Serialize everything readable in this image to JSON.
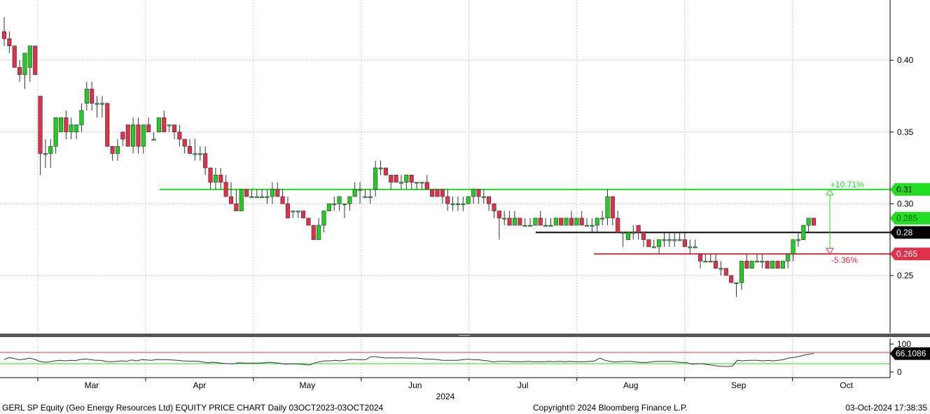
{
  "footer": {
    "title": "GERL SP Equity (Geo Energy Resources Ltd) EQUITY PRICE CHART  Daily 03OCT2023-03OCT2024",
    "copyright": "Copyright© 2024 Bloomberg Finance L.P.",
    "timestamp": "03-Oct-2024 17:38:35"
  },
  "colors": {
    "up": "#22cc22",
    "down": "#e0304a",
    "resistance": "#22dd22",
    "support": "#e0304a",
    "pivot": "#000000",
    "grid": "#c8c8c8",
    "rsi_line": "#333333"
  },
  "chart_data": [
    {
      "type": "candlestick",
      "x_ticks": [
        "Mar",
        "Apr",
        "May",
        "Jun",
        "Jul",
        "Aug",
        "Sep",
        "Oct"
      ],
      "x_year_label": "2024",
      "y_ticks": [
        "0.25",
        "0.30",
        "0.35",
        "0.40"
      ],
      "ylim": [
        0.21,
        0.442
      ],
      "levels": [
        {
          "name": "resistance",
          "value": 0.31,
          "label": "0.31",
          "pct_label": "+10.71%"
        },
        {
          "name": "pivot",
          "value": 0.28,
          "label": "0.28"
        },
        {
          "name": "support",
          "value": 0.265,
          "label": "0.265",
          "pct_label": "-5.36%"
        }
      ],
      "last_price_label": "0.285",
      "ohlc": [
        [
          0.42,
          0.43,
          0.41,
          0.415
        ],
        [
          0.415,
          0.42,
          0.405,
          0.41
        ],
        [
          0.41,
          0.41,
          0.395,
          0.395
        ],
        [
          0.395,
          0.4,
          0.385,
          0.39
        ],
        [
          0.39,
          0.405,
          0.38,
          0.405
        ],
        [
          0.395,
          0.41,
          0.385,
          0.41
        ],
        [
          0.41,
          0.41,
          0.39,
          0.39
        ],
        [
          0.375,
          0.375,
          0.32,
          0.335
        ],
        [
          0.335,
          0.345,
          0.325,
          0.335
        ],
        [
          0.335,
          0.345,
          0.325,
          0.34
        ],
        [
          0.34,
          0.36,
          0.335,
          0.36
        ],
        [
          0.35,
          0.36,
          0.35,
          0.36
        ],
        [
          0.36,
          0.365,
          0.345,
          0.35
        ],
        [
          0.35,
          0.36,
          0.345,
          0.355
        ],
        [
          0.35,
          0.355,
          0.345,
          0.355
        ],
        [
          0.355,
          0.37,
          0.35,
          0.365
        ],
        [
          0.37,
          0.385,
          0.365,
          0.38
        ],
        [
          0.38,
          0.385,
          0.365,
          0.37
        ],
        [
          0.37,
          0.375,
          0.36,
          0.37
        ],
        [
          0.37,
          0.375,
          0.36,
          0.37
        ],
        [
          0.37,
          0.37,
          0.34,
          0.34
        ],
        [
          0.34,
          0.34,
          0.33,
          0.335
        ],
        [
          0.335,
          0.345,
          0.33,
          0.34
        ],
        [
          0.35,
          0.35,
          0.34,
          0.345
        ],
        [
          0.355,
          0.355,
          0.34,
          0.34
        ],
        [
          0.34,
          0.36,
          0.335,
          0.355
        ],
        [
          0.355,
          0.36,
          0.335,
          0.34
        ],
        [
          0.34,
          0.355,
          0.335,
          0.355
        ],
        [
          0.355,
          0.36,
          0.35,
          0.35
        ],
        [
          0.345,
          0.35,
          0.345,
          0.345
        ],
        [
          0.35,
          0.36,
          0.35,
          0.36
        ],
        [
          0.36,
          0.365,
          0.35,
          0.35
        ],
        [
          0.355,
          0.355,
          0.35,
          0.355
        ],
        [
          0.355,
          0.355,
          0.345,
          0.35
        ],
        [
          0.35,
          0.355,
          0.34,
          0.345
        ],
        [
          0.345,
          0.345,
          0.335,
          0.34
        ],
        [
          0.34,
          0.345,
          0.335,
          0.335
        ],
        [
          0.335,
          0.345,
          0.33,
          0.335
        ],
        [
          0.335,
          0.34,
          0.33,
          0.335
        ],
        [
          0.335,
          0.34,
          0.32,
          0.325
        ],
        [
          0.325,
          0.325,
          0.31,
          0.315
        ],
        [
          0.315,
          0.325,
          0.31,
          0.32
        ],
        [
          0.32,
          0.325,
          0.31,
          0.315
        ],
        [
          0.315,
          0.32,
          0.305,
          0.305
        ],
        [
          0.305,
          0.315,
          0.3,
          0.3
        ],
        [
          0.3,
          0.31,
          0.295,
          0.295
        ],
        [
          0.295,
          0.31,
          0.295,
          0.31
        ],
        [
          0.31,
          0.31,
          0.305,
          0.305
        ],
        [
          0.305,
          0.31,
          0.305,
          0.305
        ],
        [
          0.305,
          0.31,
          0.305,
          0.305
        ],
        [
          0.305,
          0.31,
          0.305,
          0.305
        ],
        [
          0.305,
          0.31,
          0.3,
          0.305
        ],
        [
          0.305,
          0.315,
          0.3,
          0.31
        ],
        [
          0.31,
          0.315,
          0.305,
          0.305
        ],
        [
          0.305,
          0.31,
          0.3,
          0.3
        ],
        [
          0.3,
          0.305,
          0.29,
          0.29
        ],
        [
          0.295,
          0.295,
          0.29,
          0.295
        ],
        [
          0.295,
          0.295,
          0.29,
          0.295
        ],
        [
          0.295,
          0.295,
          0.29,
          0.29
        ],
        [
          0.29,
          0.29,
          0.285,
          0.285
        ],
        [
          0.285,
          0.285,
          0.275,
          0.275
        ],
        [
          0.275,
          0.29,
          0.275,
          0.285
        ],
        [
          0.285,
          0.295,
          0.28,
          0.295
        ],
        [
          0.295,
          0.3,
          0.295,
          0.3
        ],
        [
          0.3,
          0.305,
          0.295,
          0.3
        ],
        [
          0.3,
          0.305,
          0.295,
          0.305
        ],
        [
          0.3,
          0.3,
          0.29,
          0.3
        ],
        [
          0.3,
          0.305,
          0.295,
          0.305
        ],
        [
          0.305,
          0.315,
          0.305,
          0.31
        ],
        [
          0.31,
          0.315,
          0.3,
          0.31
        ],
        [
          0.305,
          0.31,
          0.305,
          0.305
        ],
        [
          0.305,
          0.31,
          0.3,
          0.305
        ],
        [
          0.31,
          0.33,
          0.305,
          0.325
        ],
        [
          0.325,
          0.33,
          0.32,
          0.325
        ],
        [
          0.325,
          0.325,
          0.32,
          0.32
        ],
        [
          0.32,
          0.32,
          0.31,
          0.315
        ],
        [
          0.32,
          0.32,
          0.315,
          0.315
        ],
        [
          0.315,
          0.32,
          0.31,
          0.315
        ],
        [
          0.315,
          0.32,
          0.31,
          0.32
        ],
        [
          0.32,
          0.32,
          0.31,
          0.315
        ],
        [
          0.315,
          0.315,
          0.31,
          0.315
        ],
        [
          0.315,
          0.315,
          0.31,
          0.315
        ],
        [
          0.315,
          0.32,
          0.31,
          0.31
        ],
        [
          0.31,
          0.31,
          0.305,
          0.305
        ],
        [
          0.31,
          0.31,
          0.305,
          0.305
        ],
        [
          0.31,
          0.31,
          0.3,
          0.305
        ],
        [
          0.305,
          0.31,
          0.295,
          0.3
        ],
        [
          0.3,
          0.305,
          0.295,
          0.3
        ],
        [
          0.3,
          0.305,
          0.295,
          0.3
        ],
        [
          0.3,
          0.305,
          0.295,
          0.3
        ],
        [
          0.3,
          0.305,
          0.3,
          0.305
        ],
        [
          0.305,
          0.31,
          0.3,
          0.31
        ],
        [
          0.31,
          0.31,
          0.3,
          0.305
        ],
        [
          0.305,
          0.31,
          0.3,
          0.305
        ],
        [
          0.305,
          0.305,
          0.295,
          0.3
        ],
        [
          0.3,
          0.3,
          0.29,
          0.295
        ],
        [
          0.295,
          0.295,
          0.275,
          0.29
        ],
        [
          0.29,
          0.295,
          0.285,
          0.29
        ],
        [
          0.29,
          0.295,
          0.285,
          0.285
        ],
        [
          0.285,
          0.295,
          0.285,
          0.29
        ],
        [
          0.29,
          0.29,
          0.285,
          0.285
        ],
        [
          0.285,
          0.29,
          0.285,
          0.285
        ],
        [
          0.285,
          0.29,
          0.285,
          0.285
        ],
        [
          0.285,
          0.29,
          0.285,
          0.29
        ],
        [
          0.29,
          0.295,
          0.285,
          0.285
        ],
        [
          0.285,
          0.29,
          0.285,
          0.285
        ],
        [
          0.285,
          0.29,
          0.285,
          0.285
        ],
        [
          0.285,
          0.29,
          0.285,
          0.29
        ],
        [
          0.29,
          0.29,
          0.285,
          0.285
        ],
        [
          0.285,
          0.29,
          0.285,
          0.29
        ],
        [
          0.29,
          0.295,
          0.285,
          0.285
        ],
        [
          0.285,
          0.29,
          0.285,
          0.29
        ],
        [
          0.29,
          0.295,
          0.285,
          0.285
        ],
        [
          0.285,
          0.29,
          0.285,
          0.285
        ],
        [
          0.285,
          0.29,
          0.28,
          0.285
        ],
        [
          0.285,
          0.29,
          0.28,
          0.29
        ],
        [
          0.29,
          0.295,
          0.285,
          0.29
        ],
        [
          0.29,
          0.31,
          0.285,
          0.305
        ],
        [
          0.305,
          0.305,
          0.285,
          0.29
        ],
        [
          0.29,
          0.295,
          0.28,
          0.28
        ],
        [
          0.28,
          0.28,
          0.27,
          0.28
        ],
        [
          0.275,
          0.28,
          0.275,
          0.28
        ],
        [
          0.28,
          0.285,
          0.275,
          0.28
        ],
        [
          0.285,
          0.285,
          0.275,
          0.28
        ],
        [
          0.28,
          0.275,
          0.27,
          0.275
        ],
        [
          0.275,
          0.275,
          0.27,
          0.27
        ],
        [
          0.27,
          0.275,
          0.27,
          0.27
        ],
        [
          0.27,
          0.275,
          0.265,
          0.275
        ],
        [
          0.275,
          0.28,
          0.27,
          0.275
        ],
        [
          0.275,
          0.28,
          0.27,
          0.275
        ],
        [
          0.275,
          0.28,
          0.27,
          0.275
        ],
        [
          0.275,
          0.28,
          0.275,
          0.275
        ],
        [
          0.275,
          0.28,
          0.27,
          0.27
        ],
        [
          0.27,
          0.275,
          0.265,
          0.27
        ],
        [
          0.27,
          0.275,
          0.27,
          0.27
        ],
        [
          0.265,
          0.265,
          0.255,
          0.26
        ],
        [
          0.26,
          0.265,
          0.26,
          0.26
        ],
        [
          0.26,
          0.265,
          0.26,
          0.26
        ],
        [
          0.26,
          0.265,
          0.255,
          0.255
        ],
        [
          0.255,
          0.26,
          0.25,
          0.255
        ],
        [
          0.255,
          0.255,
          0.25,
          0.25
        ],
        [
          0.25,
          0.25,
          0.245,
          0.245
        ],
        [
          0.245,
          0.245,
          0.235,
          0.245
        ],
        [
          0.245,
          0.26,
          0.24,
          0.26
        ],
        [
          0.26,
          0.265,
          0.255,
          0.255
        ],
        [
          0.255,
          0.26,
          0.255,
          0.26
        ],
        [
          0.26,
          0.265,
          0.26,
          0.26
        ],
        [
          0.26,
          0.265,
          0.255,
          0.26
        ],
        [
          0.26,
          0.26,
          0.255,
          0.255
        ],
        [
          0.255,
          0.26,
          0.255,
          0.26
        ],
        [
          0.26,
          0.26,
          0.255,
          0.255
        ],
        [
          0.255,
          0.26,
          0.255,
          0.26
        ],
        [
          0.26,
          0.265,
          0.255,
          0.265
        ],
        [
          0.265,
          0.275,
          0.26,
          0.275
        ],
        [
          0.275,
          0.28,
          0.27,
          0.275
        ],
        [
          0.275,
          0.285,
          0.275,
          0.285
        ],
        [
          0.285,
          0.29,
          0.28,
          0.29
        ],
        [
          0.29,
          0.29,
          0.285,
          0.285
        ]
      ]
    },
    {
      "type": "line",
      "name": "RSI",
      "y_ticks": [
        "100",
        "0"
      ],
      "ylim": [
        0,
        100
      ],
      "levels": [
        70,
        30
      ],
      "last_value_label": "66.1086",
      "values": [
        45,
        52,
        48,
        44,
        46,
        50,
        45,
        38,
        35,
        37,
        40,
        42,
        40,
        42,
        41,
        45,
        47,
        44,
        42,
        42,
        38,
        37,
        38,
        40,
        38,
        43,
        40,
        44,
        43,
        42,
        45,
        44,
        44,
        43,
        42,
        40,
        39,
        39,
        39,
        36,
        33,
        35,
        33,
        31,
        30,
        29,
        33,
        32,
        32,
        32,
        32,
        33,
        35,
        33,
        32,
        28,
        29,
        29,
        28,
        27,
        25,
        33,
        37,
        40,
        40,
        42,
        40,
        42,
        45,
        45,
        44,
        44,
        55,
        55,
        52,
        50,
        51,
        50,
        51,
        50,
        50,
        50,
        48,
        46,
        46,
        45,
        42,
        42,
        42,
        42,
        44,
        46,
        44,
        44,
        42,
        40,
        36,
        38,
        38,
        38,
        37,
        37,
        37,
        38,
        37,
        37,
        37,
        38,
        37,
        38,
        37,
        38,
        37,
        37,
        37,
        38,
        40,
        50,
        42,
        38,
        36,
        37,
        38,
        38,
        36,
        34,
        34,
        36,
        38,
        38,
        38,
        38,
        36,
        34,
        34,
        28,
        29,
        30,
        27,
        25,
        22,
        20,
        20,
        21,
        42,
        40,
        42,
        42,
        42,
        40,
        42,
        40,
        42,
        44,
        50,
        52,
        55,
        60,
        64,
        66
      ]
    }
  ]
}
